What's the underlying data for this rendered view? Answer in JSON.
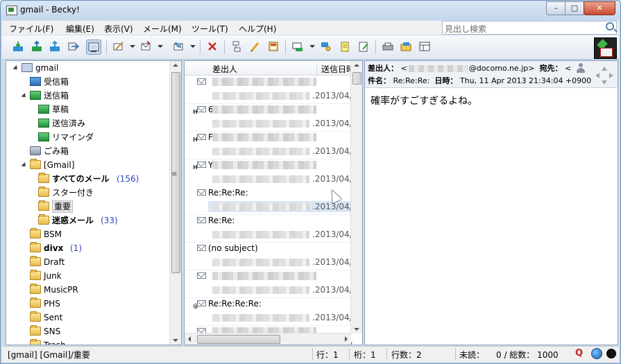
{
  "window": {
    "title": "gmail - Becky!",
    "controls": {
      "minimize": "–",
      "maximize": "□",
      "close": "✕"
    }
  },
  "menu": {
    "items": [
      "ファイル(F)",
      "編集(E)",
      "表示(V)",
      "メール(M)",
      "ツール(T)",
      "ヘルプ(H)"
    ]
  },
  "search": {
    "placeholder": "見出し検索"
  },
  "toolbar": {
    "icons": [
      "receive-icon",
      "send-receive-icon",
      "send-icon",
      "sync-icon",
      "preview-icon",
      "compose-icon",
      "reply-icon",
      "forward-icon",
      "delete-icon",
      "filter-icon",
      "edit-icon",
      "address-icon",
      "folder-move-icon",
      "find-icon",
      "note-icon",
      "memo-icon",
      "print-icon",
      "open-folder-icon",
      "layout-icon"
    ]
  },
  "folders": {
    "items": [
      {
        "label": "gmail",
        "level": 0,
        "icon": "mailbox-icon",
        "bold": false,
        "count": ""
      },
      {
        "label": "受信箱",
        "level": 1,
        "icon": "inbox-icon",
        "bold": false,
        "count": ""
      },
      {
        "label": "送信箱",
        "level": 1,
        "icon": "outbox-icon",
        "bold": false,
        "count": ""
      },
      {
        "label": "草稿",
        "level": 2,
        "icon": "draft-icon",
        "bold": false,
        "count": ""
      },
      {
        "label": "送信済み",
        "level": 2,
        "icon": "sent-icon",
        "bold": false,
        "count": ""
      },
      {
        "label": "リマインダ",
        "level": 2,
        "icon": "reminder-icon",
        "bold": false,
        "count": ""
      },
      {
        "label": "ごみ箱",
        "level": 1,
        "icon": "trash-icon",
        "bold": false,
        "count": ""
      },
      {
        "label": "[Gmail]",
        "level": 1,
        "icon": "folder-icon",
        "bold": false,
        "count": ""
      },
      {
        "label": "すべてのメール",
        "level": 2,
        "icon": "folder-icon",
        "bold": true,
        "count": "(156)"
      },
      {
        "label": "スター付き",
        "level": 2,
        "icon": "folder-icon",
        "bold": false,
        "count": ""
      },
      {
        "label": "重要",
        "level": 2,
        "icon": "folder-icon",
        "bold": false,
        "count": "",
        "selected": true
      },
      {
        "label": "迷惑メール",
        "level": 2,
        "icon": "folder-icon",
        "bold": true,
        "count": "(33)"
      },
      {
        "label": "BSM",
        "level": 1,
        "icon": "folder-icon",
        "bold": false,
        "count": ""
      },
      {
        "label": "divx",
        "level": 1,
        "icon": "folder-icon",
        "bold": true,
        "count": "(1)"
      },
      {
        "label": "Draft",
        "level": 1,
        "icon": "folder-icon",
        "bold": false,
        "count": ""
      },
      {
        "label": "Junk",
        "level": 1,
        "icon": "folder-icon",
        "bold": false,
        "count": ""
      },
      {
        "label": "MusicPR",
        "level": 1,
        "icon": "folder-icon",
        "bold": false,
        "count": ""
      },
      {
        "label": "PHS",
        "level": 1,
        "icon": "folder-icon",
        "bold": false,
        "count": ""
      },
      {
        "label": "Sent",
        "level": 1,
        "icon": "folder-icon",
        "bold": false,
        "count": ""
      },
      {
        "label": "SNS",
        "level": 1,
        "icon": "folder-icon",
        "bold": false,
        "count": ""
      },
      {
        "label": "Trash",
        "level": 1,
        "icon": "folder-icon",
        "bold": false,
        "count": ""
      }
    ]
  },
  "messages": {
    "columns": {
      "from": "差出人",
      "date": "送信日時"
    },
    "rows": [
      {
        "subject": "",
        "date": ".2013/04/",
        "flag": ""
      },
      {
        "subject": "6",
        "date": ".2013/04/",
        "flag": "H"
      },
      {
        "subject": "F",
        "date": ".2013/04/",
        "flag": "H"
      },
      {
        "subject": "Y",
        "date": ".2013/04/",
        "flag": "H"
      },
      {
        "subject": "Re:Re:Re:",
        "date": ".2013/04/",
        "flag": "",
        "selected": true
      },
      {
        "subject": "Re:Re:",
        "date": ".2013/04/",
        "flag": ""
      },
      {
        "subject": "(no subject)",
        "date": ".2013/04/",
        "flag": ""
      },
      {
        "subject": "",
        "date": ".2013/04/",
        "flag": ""
      },
      {
        "subject": "Re:Re:Re:Re:",
        "date": ".2013/04/",
        "flag": "@"
      },
      {
        "subject": "",
        "date": ".2013/04/",
        "flag": ""
      }
    ]
  },
  "reader": {
    "from_label": "差出人：",
    "from_prefix": "<",
    "from_domain": "@docomo.ne.jp>",
    "to_label": "宛先：",
    "to_value": "<",
    "subject_label": "件名：",
    "subject_value": "Re:Re:Re:",
    "date_label": "日時：",
    "date_value": "Thu, 11 Apr 2013 21:34:04 +0900",
    "body": "確率がすごすぎるよね。"
  },
  "status": {
    "path": "[gmail] [Gmail]/重要",
    "line": "行：1",
    "col": "桁：1",
    "lines": "行数：2",
    "unread": "未読：",
    "unread_total": "0 / 総数：  1000",
    "q_badge": "Q"
  }
}
